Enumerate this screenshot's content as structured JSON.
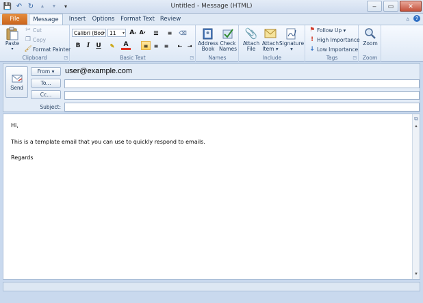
{
  "window": {
    "title": "Untitled - Message (HTML)",
    "minimize": "–",
    "restore": "▭",
    "close": "✕"
  },
  "qat": {
    "save": "💾",
    "undo": "↶",
    "redo": "↻",
    "up": "▲",
    "down": "▼",
    "more": "▾"
  },
  "tabs": [
    {
      "label": "File"
    },
    {
      "label": "Message"
    },
    {
      "label": "Insert"
    },
    {
      "label": "Options"
    },
    {
      "label": "Format Text"
    },
    {
      "label": "Review"
    }
  ],
  "tab_controls": {
    "collapse": "▵",
    "help": "?"
  },
  "ribbon": {
    "clipboard": {
      "label": "Clipboard",
      "paste": "Paste",
      "cut": "Cut",
      "copy": "Copy",
      "format_painter": "Format Painter"
    },
    "basic_text": {
      "label": "Basic Text",
      "font": "Calibri (Bod",
      "size": "11",
      "bold": "B",
      "italic": "I",
      "underline": "U"
    },
    "names": {
      "label": "Names",
      "address_book_1": "Address",
      "address_book_2": "Book",
      "check_names_1": "Check",
      "check_names_2": "Names"
    },
    "include": {
      "label": "Include",
      "attach_file_1": "Attach",
      "attach_file_2": "File",
      "attach_item_1": "Attach",
      "attach_item_2": "Item ▾",
      "signature_1": "Signature",
      "signature_2": "▾"
    },
    "tags": {
      "label": "Tags",
      "follow_up": "Follow Up ▾",
      "high": "High Importance",
      "low": "Low Importance"
    },
    "zoom": {
      "label": "Zoom",
      "zoom": "Zoom"
    }
  },
  "header": {
    "send": "Send",
    "from": "From ▾",
    "from_value": "user@example.com",
    "to": "To...",
    "cc": "Cc...",
    "subject": "Subject:"
  },
  "body": {
    "line1": "Hi,",
    "line2": "This is a template email that you can use to quickly respond to emails.",
    "line3": "Regards"
  },
  "scroll": {
    "up": "▲",
    "down": "▼"
  }
}
